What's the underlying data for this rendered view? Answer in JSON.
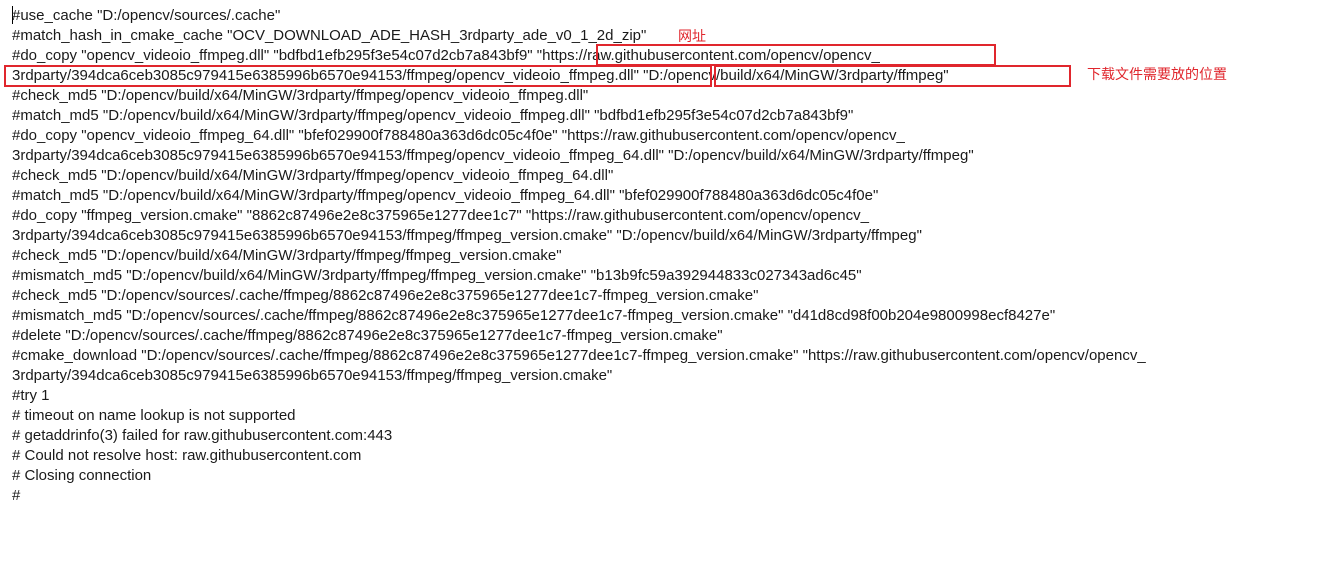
{
  "lines": [
    "#use_cache \"D:/opencv/sources/.cache\"",
    "#match_hash_in_cmake_cache \"OCV_DOWNLOAD_ADE_HASH_3rdparty_ade_v0_1_2d_zip\"",
    "#do_copy \"opencv_videoio_ffmpeg.dll\" \"bdfbd1efb295f3e54c07d2cb7a843bf9\" \"https://raw.githubusercontent.com/opencv/opencv_",
    "3rdparty/394dca6ceb3085c979415e6385996b6570e94153/ffmpeg/opencv_videoio_ffmpeg.dll\" \"D:/opencv/build/x64/MinGW/3rdparty/ffmpeg\"",
    "#check_md5 \"D:/opencv/build/x64/MinGW/3rdparty/ffmpeg/opencv_videoio_ffmpeg.dll\"",
    "#match_md5 \"D:/opencv/build/x64/MinGW/3rdparty/ffmpeg/opencv_videoio_ffmpeg.dll\" \"bdfbd1efb295f3e54c07d2cb7a843bf9\"",
    "#do_copy \"opencv_videoio_ffmpeg_64.dll\" \"bfef029900f788480a363d6dc05c4f0e\" \"https://raw.githubusercontent.com/opencv/opencv_",
    "3rdparty/394dca6ceb3085c979415e6385996b6570e94153/ffmpeg/opencv_videoio_ffmpeg_64.dll\" \"D:/opencv/build/x64/MinGW/3rdparty/ffmpeg\"",
    "#check_md5 \"D:/opencv/build/x64/MinGW/3rdparty/ffmpeg/opencv_videoio_ffmpeg_64.dll\"",
    "#match_md5 \"D:/opencv/build/x64/MinGW/3rdparty/ffmpeg/opencv_videoio_ffmpeg_64.dll\" \"bfef029900f788480a363d6dc05c4f0e\"",
    "#do_copy \"ffmpeg_version.cmake\" \"8862c87496e2e8c375965e1277dee1c7\" \"https://raw.githubusercontent.com/opencv/opencv_",
    "3rdparty/394dca6ceb3085c979415e6385996b6570e94153/ffmpeg/ffmpeg_version.cmake\" \"D:/opencv/build/x64/MinGW/3rdparty/ffmpeg\"",
    "#check_md5 \"D:/opencv/build/x64/MinGW/3rdparty/ffmpeg/ffmpeg_version.cmake\"",
    "#mismatch_md5 \"D:/opencv/build/x64/MinGW/3rdparty/ffmpeg/ffmpeg_version.cmake\" \"b13b9fc59a392944833c027343ad6c45\"",
    "#check_md5 \"D:/opencv/sources/.cache/ffmpeg/8862c87496e2e8c375965e1277dee1c7-ffmpeg_version.cmake\"",
    "#mismatch_md5 \"D:/opencv/sources/.cache/ffmpeg/8862c87496e2e8c375965e1277dee1c7-ffmpeg_version.cmake\" \"d41d8cd98f00b204e9800998ecf8427e\"",
    "#delete \"D:/opencv/sources/.cache/ffmpeg/8862c87496e2e8c375965e1277dee1c7-ffmpeg_version.cmake\"",
    "#cmake_download \"D:/opencv/sources/.cache/ffmpeg/8862c87496e2e8c375965e1277dee1c7-ffmpeg_version.cmake\" \"https://raw.githubusercontent.com/opencv/opencv_",
    "3rdparty/394dca6ceb3085c979415e6385996b6570e94153/ffmpeg/ffmpeg_version.cmake\"",
    "#try 1",
    "# timeout on name lookup is not supported",
    "# getaddrinfo(3) failed for raw.githubusercontent.com:443",
    "# Could not resolve host: raw.githubusercontent.com",
    "# Closing connection",
    "#"
  ],
  "annotations": {
    "url_label": "网址",
    "dest_label": "下载文件需要放的位置"
  },
  "colors": {
    "annotation": "#e0262d",
    "text": "#1a1a1a"
  }
}
